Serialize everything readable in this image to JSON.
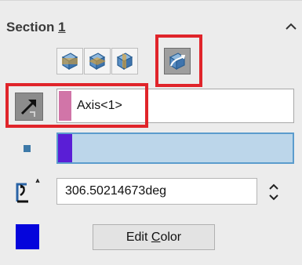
{
  "section": {
    "title_prefix": "Section ",
    "title_number": "1",
    "collapse_icon": "chevron-up-icon"
  },
  "plane_buttons": [
    {
      "icon": "front-plane-icon"
    },
    {
      "icon": "top-plane-icon"
    },
    {
      "icon": "right-plane-icon"
    },
    {
      "icon": "selection-plane-icon",
      "active": true
    }
  ],
  "axis": {
    "icon": "pick-reference-icon",
    "value": "Axis<1>",
    "swatch_color": "#d175a8"
  },
  "offset_slider": {
    "fill": 0.06,
    "thumb_color": "#5a1ed6",
    "track_color": "#bcd6ea"
  },
  "angle": {
    "icon": "rotation-angle-icon",
    "value": "306.50214673deg",
    "spinner_icon": "up-down-spinner-icon"
  },
  "color": {
    "swatch": "#0505dc",
    "edit_button": {
      "pre": "Edit ",
      "underlined": "C",
      "post": "olor"
    }
  },
  "highlight_color": "#e0242a"
}
